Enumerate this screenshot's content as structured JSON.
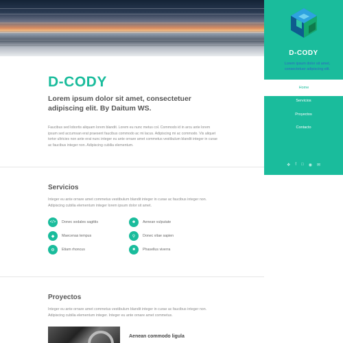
{
  "hero": {
    "alt": ""
  },
  "brand": {
    "title": "D-CODY",
    "tagline": "Lorem ipsum dolor sit amet, consectetuer adipiscing elit. By Daitum WS.",
    "intro": "Faucibus sed lobortis aliquam lorem blandit. Lorem eu nunc metus col. Commodo id in arcu ante lorem ipsum sed accumsan erat praesent faucibus commodo ac mi lacus. Adipiscing mi ac commodo. Vis aliquet tortor ultricies non ante erat nunc integer eu ante ornare amet commetus vestibulum blandit integer in curae ac faucibus integer non. Adipiscing cubilia elementum."
  },
  "services": {
    "title": "Servicios",
    "desc": "Integer eu ante ornare amet commetus vestibulum blandit integer in curae ac faucibus integer non. Adipiscing cubilia elementum integer lorem ipsum dolor sit amet.",
    "items": [
      {
        "label": "Donec sodales sagittis",
        "icon": "code-icon"
      },
      {
        "label": "Aenean vulputate",
        "icon": "user-icon"
      },
      {
        "label": "Maecenas tempus",
        "icon": "cube-icon"
      },
      {
        "label": "Donec vitae sapien",
        "icon": "search-icon"
      },
      {
        "label": "Etiam rhoncus",
        "icon": "wrench-icon"
      },
      {
        "label": "Phasellus viverra",
        "icon": "lock-icon"
      }
    ]
  },
  "projects": {
    "title": "Proyectos",
    "desc": "Integer eu ante ornare amet commetus vestibulum blandit integer in curae ac faucibus integer non. Adipiscing cubilia elementum integer. Integer eu ante ornare amet commetus.",
    "first_title": "Aenean commodo ligula"
  },
  "sidebar": {
    "title": "D-CODY",
    "desc": "Lorem ipsum dolor sit amet, consectetuer adipiscing elit.",
    "nav": [
      "Home",
      "Servicios",
      "Proyectos",
      "Contacto"
    ],
    "social": [
      "twitter-icon",
      "facebook-icon",
      "instagram-icon",
      "github-icon",
      "email-icon"
    ]
  },
  "colors": {
    "accent": "#1abc9c",
    "sidebar_desc": "#2f63c4"
  }
}
